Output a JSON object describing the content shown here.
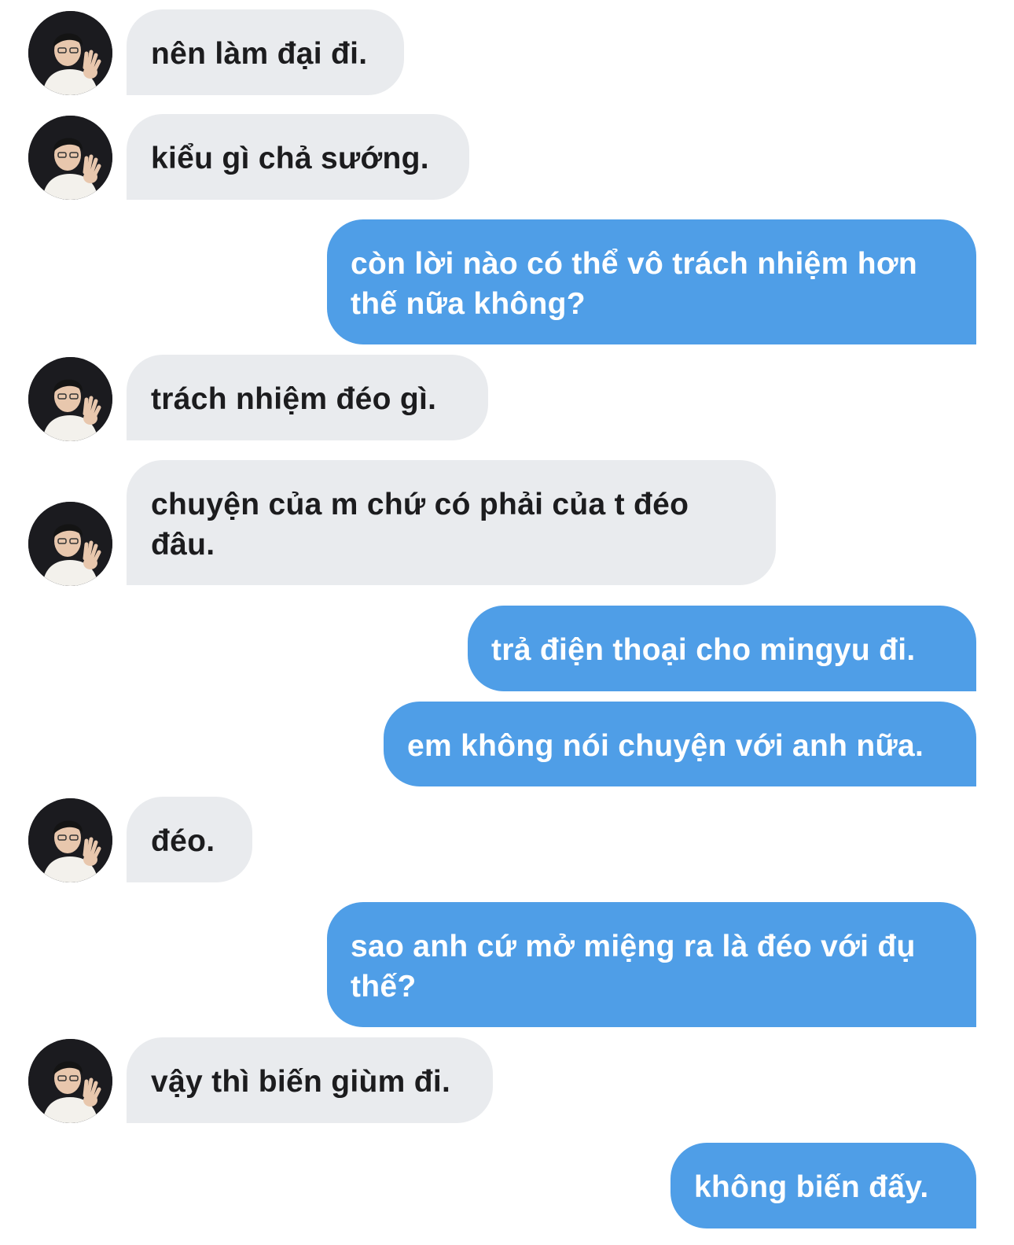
{
  "conversation": {
    "messages": [
      {
        "sender": "contact",
        "text": "nên làm đại đi."
      },
      {
        "sender": "contact",
        "text": "kiểu gì chả sướng."
      },
      {
        "sender": "me",
        "text": "còn lời nào có thể vô trách nhiệm hơn thế nữa không?"
      },
      {
        "sender": "contact",
        "text": "trách nhiệm đéo gì."
      },
      {
        "sender": "contact",
        "text": "chuyện của m chứ có phải của t đéo đâu."
      },
      {
        "sender": "me",
        "text": "trả điện thoại cho mingyu đi."
      },
      {
        "sender": "me",
        "text": "em không nói chuyện với anh nữa."
      },
      {
        "sender": "contact",
        "text": "đéo."
      },
      {
        "sender": "me",
        "text": "sao anh cứ mở miệng ra là đéo với đụ thế?"
      },
      {
        "sender": "contact",
        "text": "vậy thì biến giùm đi."
      },
      {
        "sender": "me",
        "text": "không biến đấy."
      }
    ]
  },
  "colors": {
    "incoming_bubble": "#e9ebee",
    "incoming_text": "#1c1c1e",
    "outgoing_bubble": "#4f9ee7",
    "outgoing_text": "#ffffff"
  },
  "icons": {
    "contact_avatar": "contact-avatar-photo"
  }
}
